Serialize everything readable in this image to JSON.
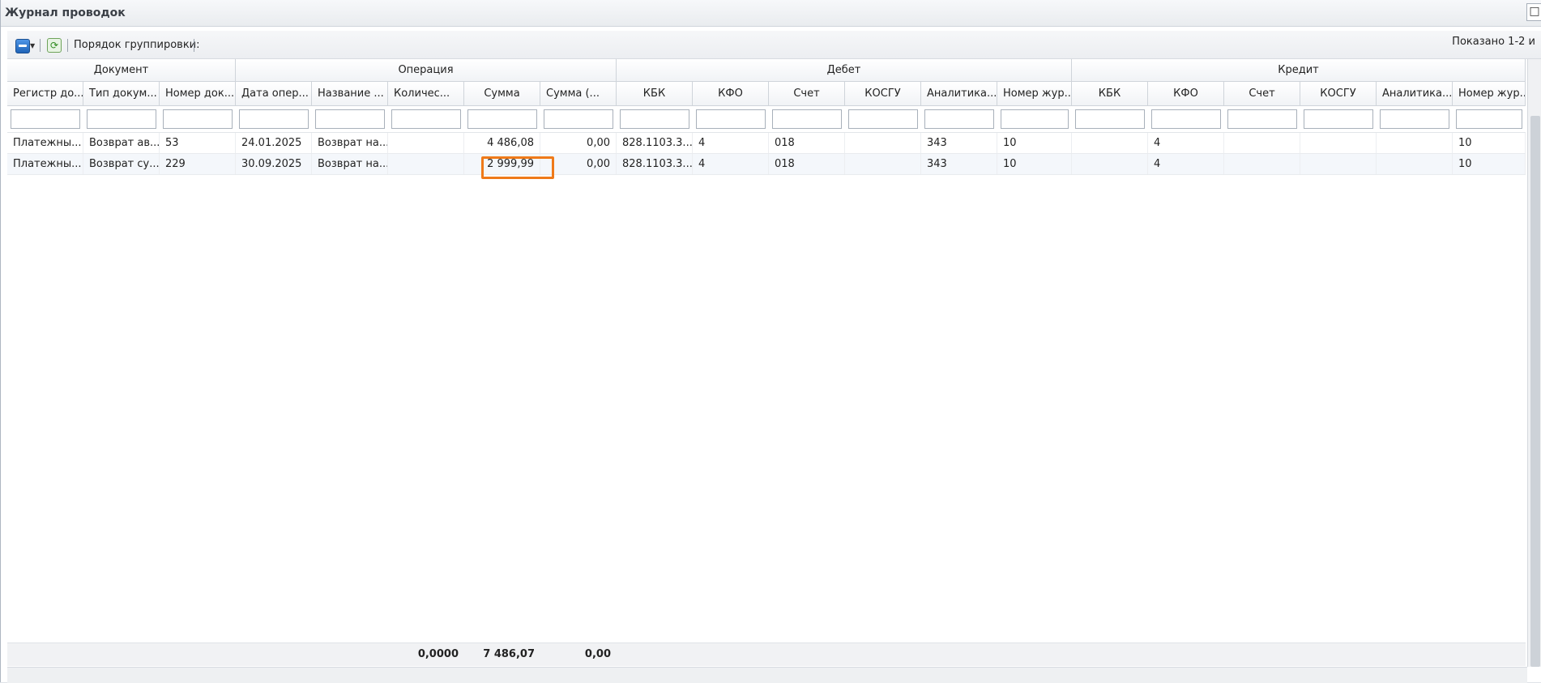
{
  "window": {
    "title": "Журнал проводок",
    "close_icon": "□"
  },
  "toolbar": {
    "print_icon": "print-icon",
    "refresh_icon": "⟳",
    "group_label": "Порядок группировки:",
    "shown_text": "Показано 1-2 и"
  },
  "groups": {
    "document": "Документ",
    "operation": "Операция",
    "debit": "Дебет",
    "credit": "Кредит"
  },
  "columns": [
    "Регистр до...",
    "Тип докум...",
    "Номер док...",
    "Дата опер...",
    "Название ...",
    "Количес...",
    "Сумма",
    "Сумма (...",
    "КБК",
    "КФО",
    "Счет",
    "КОСГУ",
    "Аналитика...",
    "Номер жур...",
    "КБК",
    "КФО",
    "Счет",
    "КОСГУ",
    "Аналитика...",
    "Номер жур..."
  ],
  "rows": [
    [
      "Платежны...",
      "Возврат ав...",
      "53",
      "24.01.2025",
      "Возврат на...",
      "",
      "4 486,08",
      "0,00",
      "828.1103.3...",
      "4",
      "018",
      "",
      "343",
      "10",
      "",
      "4",
      "",
      "",
      "",
      "10"
    ],
    [
      "Платежны...",
      "Возврат су...",
      "229",
      "30.09.2025",
      "Возврат на...",
      "",
      "2 999,99",
      "0,00",
      "828.1103.3...",
      "4",
      "018",
      "",
      "343",
      "10",
      "",
      "4",
      "",
      "",
      "",
      "10"
    ]
  ],
  "totals": {
    "quantity": "0,0000",
    "sum": "7 486,07",
    "sum2": "0,00"
  },
  "highlight_color": "#ef7a19"
}
